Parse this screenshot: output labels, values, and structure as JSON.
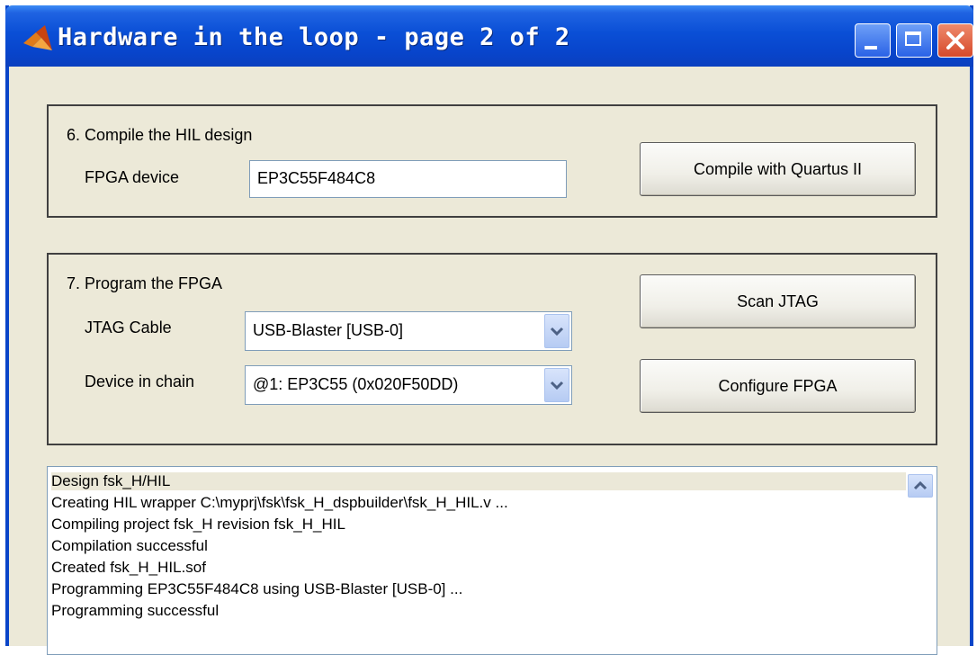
{
  "window": {
    "title": "Hardware in the loop - page 2 of 2",
    "controls": [
      "minimize-icon",
      "maximize-icon",
      "close-icon"
    ]
  },
  "step6": {
    "heading": "6. Compile the HIL design",
    "fpga_label": "FPGA device",
    "fpga_value": "EP3C55F484C8",
    "compile_button": "Compile with Quartus II"
  },
  "step7": {
    "heading": "7. Program the FPGA",
    "jtag_label": "JTAG Cable",
    "jtag_value": "USB-Blaster [USB-0]",
    "device_label": "Device in chain",
    "device_value": "@1: EP3C55 (0x020F50DD)",
    "scan_button": "Scan JTAG",
    "configure_button": "Configure FPGA"
  },
  "log": {
    "lines": [
      "Design fsk_H/HIL",
      "Creating HIL wrapper C:\\myprj\\fsk\\fsk_H_dspbuilder\\fsk_H_HIL.v ...",
      "Compiling project fsk_H revision fsk_H_HIL",
      "Compilation successful",
      "Created fsk_H_HIL.sof",
      "Programming EP3C55F484C8 using USB-Blaster [USB-0] ...",
      "Programming successful"
    ]
  }
}
